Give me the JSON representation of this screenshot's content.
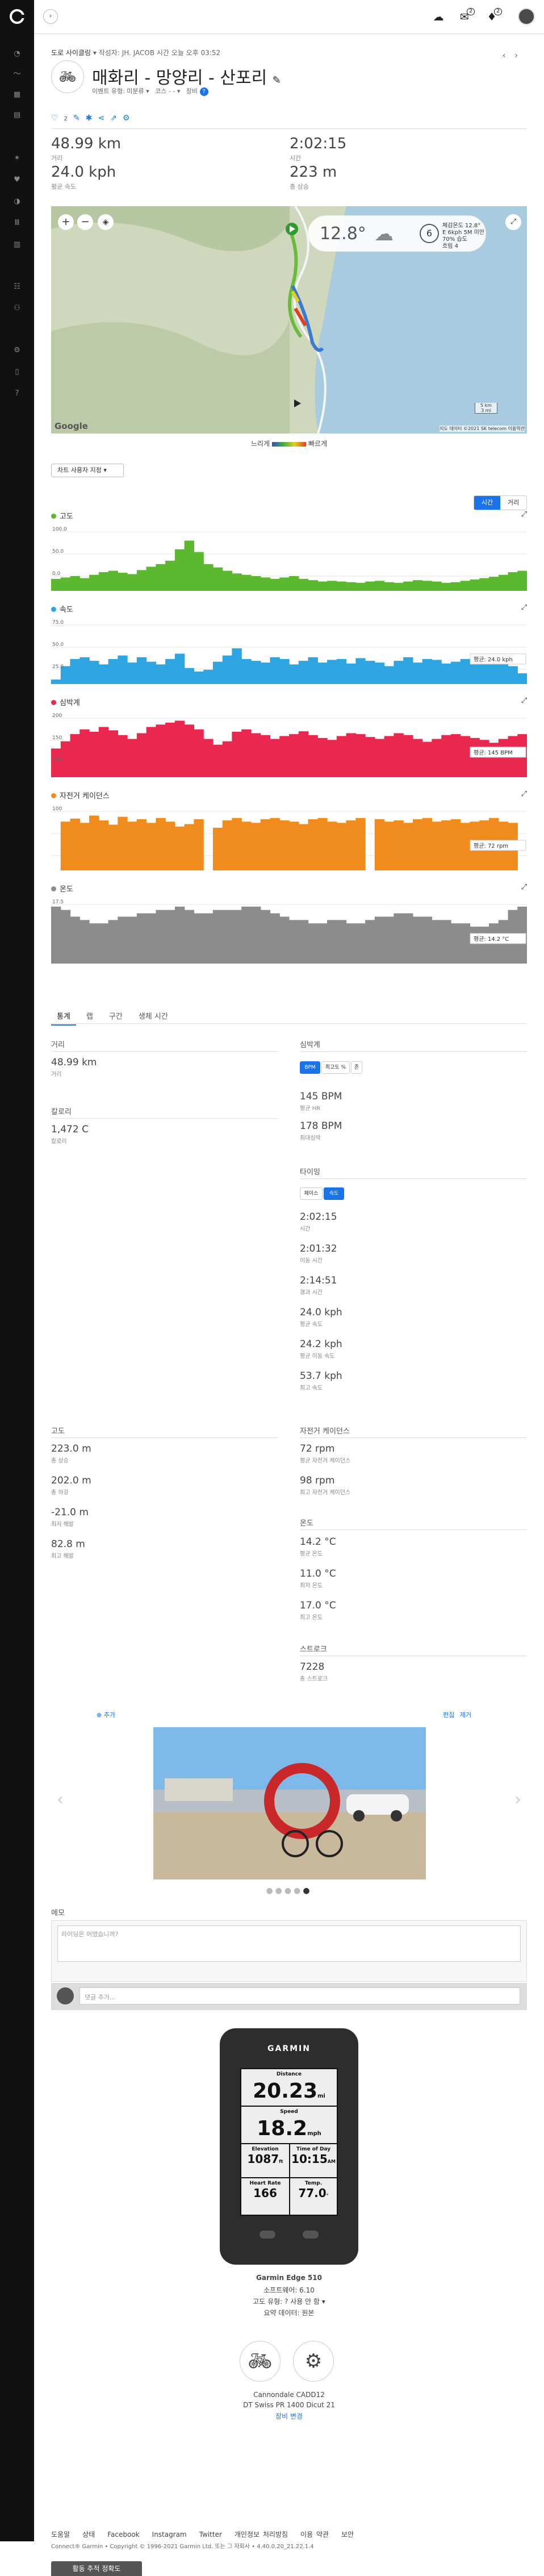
{
  "header": {
    "breadcrumb_prefix": "도로 사이클링",
    "breadcrumb_by": "작성자: JH. JACOB",
    "breadcrumb_time": "시간 오늘 오후 03:52",
    "title": "매화리 - 망양리 - 산포리",
    "subtitle_privacy": "이벤트 유형: 미분류",
    "subtitle_course": "코스 - -",
    "subtitle_gear": "장비",
    "likes": "2"
  },
  "summary": [
    {
      "value": "48.99 km",
      "label": "거리"
    },
    {
      "value": "2:02:15",
      "label": "시간"
    },
    {
      "value": "24.0 kph",
      "label": "평균 속도"
    },
    {
      "value": "223 m",
      "label": "총 상승"
    }
  ],
  "map": {
    "temperature": "12.8°",
    "wind": "6",
    "weather_lines": [
      "체감온도 12.8°",
      "E 6kph 5M 미만",
      "70% 습도",
      "흐림 4"
    ],
    "google": "Google",
    "scale_km": "5 km",
    "scale_mi": "3 mi",
    "attribution": "지도 데이터 ©2021 SK telecom 이용약관"
  },
  "legend": {
    "slow": "느리게",
    "fast": "빠르게"
  },
  "chart_dropdown": "차트 사용자 지정 ▾",
  "x_toggle": {
    "time": "시간",
    "distance": "거리"
  },
  "charts": [
    {
      "title": "고도",
      "color": "#5cb82f",
      "ymax": "100.0",
      "ymid": "50.0",
      "ylow": "0.0",
      "badge": ""
    },
    {
      "title": "속도",
      "color": "#2ea5e0",
      "ymax": "75.0",
      "ymid": "50.0",
      "ylow": "25.0",
      "badge": "평균: 24.0 kph"
    },
    {
      "title": "심박계",
      "color": "#e8284f",
      "ymax": "200",
      "ymid": "150",
      "ylow": "100",
      "badge": "평균: 145 BPM"
    },
    {
      "title": "자전거 케이던스",
      "color": "#f08c1e",
      "ymax": "100",
      "ymid": "",
      "ylow": "",
      "badge": "평균: 72 rpm"
    },
    {
      "title": "온도",
      "color": "#8c8c8c",
      "ymax": "17.5",
      "ymid": "",
      "ylow": "",
      "badge": "평균: 14.2 °C"
    }
  ],
  "chart_data": [
    {
      "type": "area",
      "title": "고도",
      "ylim": [
        0,
        100
      ],
      "y": [
        18,
        20,
        22,
        19,
        24,
        28,
        30,
        27,
        25,
        31,
        36,
        40,
        45,
        62,
        75,
        58,
        40,
        35,
        30,
        26,
        24,
        22,
        20,
        18,
        20,
        22,
        18,
        16,
        14,
        15,
        14,
        13,
        12,
        14,
        15,
        13,
        12,
        14,
        16,
        15,
        14,
        12,
        13,
        15,
        17,
        19,
        21,
        24,
        28,
        30
      ]
    },
    {
      "type": "area",
      "title": "속도",
      "ylim": [
        0,
        75
      ],
      "y": [
        5,
        20,
        28,
        30,
        26,
        22,
        28,
        32,
        24,
        30,
        25,
        22,
        28,
        34,
        18,
        14,
        16,
        25,
        32,
        40,
        28,
        26,
        24,
        30,
        28,
        22,
        26,
        30,
        24,
        27,
        28,
        23,
        29,
        26,
        24,
        20,
        26,
        30,
        24,
        28,
        27,
        23,
        25,
        28,
        22,
        26,
        24,
        28,
        20,
        12
      ]
    },
    {
      "type": "area",
      "title": "심박계",
      "ylim": [
        60,
        200
      ],
      "y": [
        120,
        135,
        150,
        160,
        155,
        165,
        158,
        148,
        140,
        152,
        165,
        170,
        174,
        178,
        170,
        160,
        140,
        128,
        135,
        155,
        160,
        152,
        148,
        140,
        146,
        150,
        156,
        148,
        142,
        138,
        146,
        152,
        150,
        144,
        140,
        146,
        152,
        148,
        140,
        134,
        140,
        148,
        150,
        146,
        142,
        138,
        132,
        140,
        146,
        150
      ]
    },
    {
      "type": "area",
      "title": "자전거 케이던스",
      "ylim": [
        0,
        110
      ],
      "y": [
        0,
        80,
        85,
        78,
        90,
        82,
        75,
        88,
        80,
        84,
        78,
        86,
        80,
        72,
        76,
        84,
        0,
        70,
        82,
        86,
        80,
        78,
        84,
        86,
        82,
        80,
        76,
        84,
        86,
        80,
        78,
        82,
        86,
        0,
        84,
        80,
        82,
        78,
        84,
        86,
        80,
        82,
        84,
        78,
        80,
        82,
        86,
        80,
        78,
        0
      ]
    },
    {
      "type": "area",
      "title": "온도",
      "ylim": [
        0,
        20
      ],
      "y": [
        17,
        16,
        14,
        13,
        12,
        12,
        13,
        14,
        14,
        15,
        15,
        16,
        16,
        17,
        16,
        15,
        15,
        16,
        16,
        16,
        17,
        17,
        16,
        15,
        14,
        13,
        13,
        12,
        12,
        13,
        13,
        12,
        12,
        13,
        14,
        14,
        15,
        15,
        14,
        14,
        13,
        13,
        12,
        12,
        11,
        11,
        12,
        13,
        16,
        17
      ]
    }
  ],
  "tabs": [
    "통계",
    "랩",
    "구간",
    "생체 시간"
  ],
  "stats": {
    "distance_h": "거리",
    "distance_v": "48.99 km",
    "distance_l": "거리",
    "calories_h": "칼로리",
    "calories_v": "1,472 C",
    "calories_l": "칼로리",
    "hr_h": "심박계",
    "hr_pills": [
      "BPM",
      "최고도 %",
      "존"
    ],
    "hr_avg_v": "145 BPM",
    "hr_avg_l": "평균 HR",
    "hr_max_v": "178 BPM",
    "hr_max_l": "최대심박",
    "timing_h": "타이밍",
    "timing_pills": [
      "페이스",
      "속도"
    ],
    "timing": [
      {
        "v": "2:02:15",
        "l": "시간"
      },
      {
        "v": "2:01:32",
        "l": "이동 시간"
      },
      {
        "v": "2:14:51",
        "l": "경과 시간"
      },
      {
        "v": "24.0 kph",
        "l": "평균 속도"
      },
      {
        "v": "24.2 kph",
        "l": "평균 이동 속도"
      },
      {
        "v": "53.7 kph",
        "l": "최고 속도"
      }
    ],
    "elev_h": "고도",
    "elev": [
      {
        "v": "223.0 m",
        "l": "총 상승"
      },
      {
        "v": "202.0 m",
        "l": "총 하강"
      },
      {
        "v": "-21.0 m",
        "l": "최저 해발"
      },
      {
        "v": "82.8 m",
        "l": "최고 해발"
      }
    ],
    "cad_h": "자전거 케이던스",
    "cad": [
      {
        "v": "72 rpm",
        "l": "평균 자전거 케이던스"
      },
      {
        "v": "98 rpm",
        "l": "최고 자전거 케이던스"
      }
    ],
    "temp_h": "온도",
    "temp": [
      {
        "v": "14.2 °C",
        "l": "평균 온도"
      },
      {
        "v": "11.0 °C",
        "l": "최저 온도"
      },
      {
        "v": "17.0 °C",
        "l": "최고 온도"
      }
    ],
    "strokes_h": "스트로크",
    "strokes_v": "7228",
    "strokes_l": "총 스트로크"
  },
  "photos": {
    "add": "추가",
    "edit": "편집",
    "delete": "제거"
  },
  "memo": {
    "title": "메모",
    "placeholder": "라이딩은 어땠습니까?",
    "comment_placeholder": "댓글 추가..."
  },
  "device": {
    "brand": "GARMIN",
    "screen": [
      {
        "l": "Distance",
        "v": "20.23",
        "u": "mi"
      },
      {
        "l": "Speed",
        "v": "18.2",
        "u": "mph"
      },
      {
        "l": "Elevation",
        "v": "1087",
        "u": "ft"
      },
      {
        "l": "Time of Day",
        "v": "10:15",
        "u": "AM"
      },
      {
        "l": "Heart Rate",
        "v": "166",
        "u": ""
      },
      {
        "l": "Temp.",
        "v": "77.0",
        "u": "°"
      }
    ],
    "name": "Garmin Edge 510",
    "software": "소프트웨어: 6.10",
    "elev_source": "고도 유형: ? 사용 안 함 ▾",
    "summary": "요약 데이터: 원본",
    "bike": "Cannondale CADD12",
    "wheel": "DT Swiss PR 1400 Dicut 21",
    "change": "장비 변경"
  },
  "footer": {
    "links": [
      "도움말",
      "상태",
      "Facebook",
      "Instagram",
      "Twitter",
      "개인정보 처리방침",
      "이용 약관",
      "보안"
    ],
    "copyright": "Connect® Garmin • Copyright © 1996-2021 Garmin Ltd. 또는 그 자회사 • 4.40.0.20_21.22.1.4",
    "track_button": "활동 추적 정확도"
  }
}
